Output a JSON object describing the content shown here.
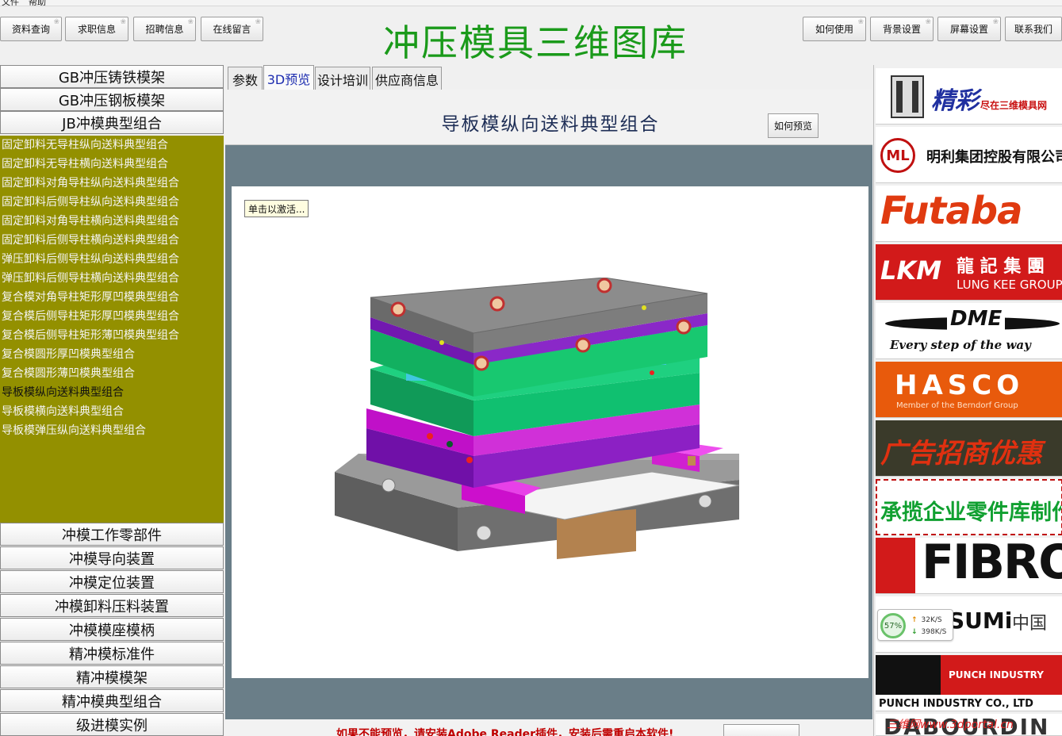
{
  "menubar": {
    "items": [
      "文件",
      "帮助"
    ]
  },
  "top_buttons_left": [
    "资料查询",
    "求职信息",
    "招聘信息",
    "在线留言"
  ],
  "app_title": "冲压模具三维图库",
  "top_buttons_right": [
    "如何使用",
    "背景设置",
    "屏幕设置",
    "联系我们"
  ],
  "categories_top": [
    "GB冲压铸铁模架",
    "GB冲压钢板模架",
    "JB冲模典型组合"
  ],
  "subitems": [
    "固定卸料无导柱纵向送料典型组合",
    "固定卸料无导柱横向送料典型组合",
    "固定卸料对角导柱纵向送料典型组合",
    "固定卸料后侧导柱纵向送料典型组合",
    "固定卸料对角导柱横向送料典型组合",
    "固定卸料后侧导柱横向送料典型组合",
    "弹压卸料后侧导柱纵向送料典型组合",
    "弹压卸料后侧导柱横向送料典型组合",
    "复合模对角导柱矩形厚凹模典型组合",
    "复合模后侧导柱矩形厚凹模典型组合",
    "复合模后侧导柱矩形薄凹模典型组合",
    "复合模圆形厚凹模典型组合",
    "复合模圆形薄凹模典型组合",
    "导板模纵向送料典型组合",
    "导板模横向送料典型组合",
    "导板模弹压纵向送料典型组合"
  ],
  "active_subitem_index": 13,
  "categories_bottom": [
    "冲模工作零部件",
    "冲模导向装置",
    "冲模定位装置",
    "冲模卸料压料装置",
    "冲模模座模柄",
    "精冲模标准件",
    "精冲模模架",
    "精冲模典型组合",
    "级进模实例"
  ],
  "tabs": [
    "参数",
    "3D预览",
    "设计培训",
    "供应商信息"
  ],
  "active_tab": "3D预览",
  "content_title": "导板模纵向送料典型组合",
  "how_preview_label": "如何预览",
  "activate_label": "单击以激活...",
  "bottom_warning": "如果不能预览，请安装Adobe Reader插件，安装后需重启本软件!",
  "ads": {
    "jingcai": {
      "main": "精彩",
      "sub": "尽在三维模具网"
    },
    "mingli": {
      "logo": "ML",
      "text": "明利集团控股有限公司"
    },
    "futaba": {
      "text": "Futaba"
    },
    "lkm": {
      "logo": "LKM",
      "cn": "龍 記 集 團",
      "en": "LUNG KEE GROUP"
    },
    "dme": {
      "logo": "DME",
      "slogan": "Every step of the way"
    },
    "hasco": {
      "logo": "HASCO",
      "sub": "Member of the Berndorf Group"
    },
    "guanggao": {
      "text": "广告招商优惠"
    },
    "chenglan": {
      "text": "承揽企业零件库制作"
    },
    "fibro": {
      "text": "FIBRO"
    },
    "misumi": {
      "logo": "SUMi",
      "cn": "中国"
    },
    "punch": {
      "logo_text": "PUNCH INDUSTRY",
      "company": "PUNCH INDUSTRY CO., LTD"
    },
    "dabourdin": {
      "text": "DABOURDIN"
    }
  },
  "netspeed": {
    "percent": "57%",
    "up": "32K/S",
    "down": "398K/S"
  },
  "watermark": "三维网www.3dportal.cn",
  "colors": {
    "title_green": "#1a9a1a",
    "olive_panel": "#939000",
    "viewer_bg": "#6a7e88",
    "warning_red": "#c00000"
  }
}
